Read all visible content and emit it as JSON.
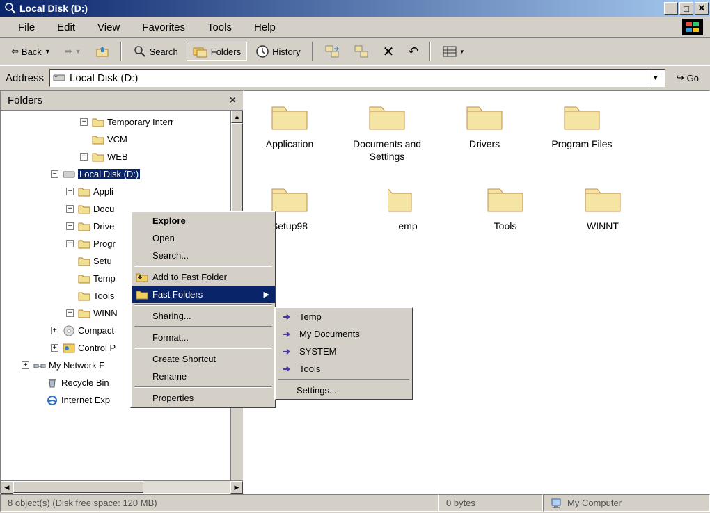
{
  "titlebar": {
    "title": "Local Disk (D:)"
  },
  "menubar": {
    "items": [
      "File",
      "Edit",
      "View",
      "Favorites",
      "Tools",
      "Help"
    ]
  },
  "toolbar": {
    "back": "Back",
    "search": "Search",
    "folders": "Folders",
    "history": "History"
  },
  "addressbar": {
    "label": "Address",
    "value": "Local Disk (D:)",
    "go": "Go"
  },
  "folders_pane": {
    "title": "Folders",
    "tree": {
      "temp_internet": "Temporary Interr",
      "vcm": "VCM",
      "web": "WEB",
      "local_disk": "Local Disk (D:)",
      "application": "Appli",
      "documents": "Docu",
      "drivers": "Drive",
      "program": "Progr",
      "setup": "Setu",
      "temp": "Temp",
      "tools": "Tools",
      "winnt": "WINN",
      "compact": "Compact",
      "control": "Control P",
      "network": "My Network F",
      "recycle": "Recycle Bin",
      "ie": "Internet Exp"
    }
  },
  "files": {
    "items": [
      {
        "name": "Application"
      },
      {
        "name": "Documents and Settings"
      },
      {
        "name": "Drivers"
      },
      {
        "name": "Program Files"
      },
      {
        "name": "Setup98"
      },
      {
        "name": "emp",
        "partial": true
      },
      {
        "name": "Tools"
      },
      {
        "name": "WINNT"
      }
    ]
  },
  "context_menu": {
    "explore": "Explore",
    "open": "Open",
    "search": "Search...",
    "add_fast": "Add to Fast Folder",
    "fast_folders": "Fast Folders",
    "sharing": "Sharing...",
    "format": "Format...",
    "create_shortcut": "Create Shortcut",
    "rename": "Rename",
    "properties": "Properties"
  },
  "submenu": {
    "temp": "Temp",
    "my_documents": "My Documents",
    "system": "SYSTEM",
    "tools": "Tools",
    "settings": "Settings..."
  },
  "statusbar": {
    "objects": "8 object(s) (Disk free space: 120 MB)",
    "size": "0 bytes",
    "location": "My Computer"
  }
}
